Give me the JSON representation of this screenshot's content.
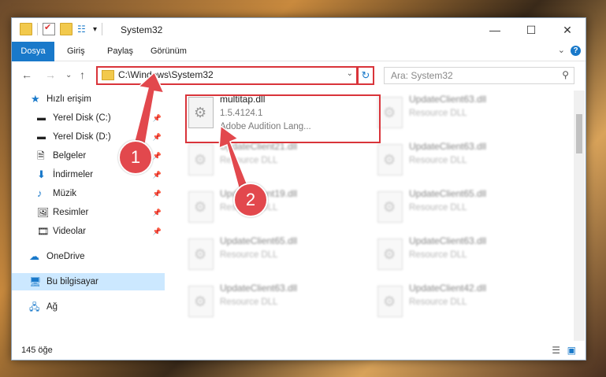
{
  "window": {
    "title": "System32"
  },
  "ribbon": {
    "tabs": [
      "Dosya",
      "Giriş",
      "Paylaş",
      "Görünüm"
    ],
    "help": "?"
  },
  "address": {
    "path": "C:\\Windows\\System32"
  },
  "search": {
    "placeholder": "Ara: System32"
  },
  "nav": {
    "items": [
      {
        "label": "Hızlı erişim"
      },
      {
        "label": "Yerel Disk (C:)"
      },
      {
        "label": "Yerel Disk (D:)"
      },
      {
        "label": "Belgeler"
      },
      {
        "label": "İndirmeler"
      },
      {
        "label": "Müzik"
      },
      {
        "label": "Resimler"
      },
      {
        "label": "Videolar"
      },
      {
        "label": "OneDrive"
      },
      {
        "label": "Bu bilgisayar"
      },
      {
        "label": "Ağ"
      }
    ]
  },
  "files": [
    {
      "name": "multitap.dll",
      "version": "1.5.4124.1",
      "description": "Adobe Audition Lang..."
    },
    {
      "name": "UpdateClient63.dll",
      "description": "Resource DLL"
    },
    {
      "name": "UpdateClient21.dll",
      "description": "Resource DLL"
    },
    {
      "name": "UpdateClient63.dll",
      "description": "Resource DLL"
    },
    {
      "name": "UpdateClient19.dll",
      "description": "Resource DLL"
    },
    {
      "name": "UpdateClient65.dll",
      "description": "Resource DLL"
    },
    {
      "name": "UpdateClient65.dll",
      "description": "Resource DLL"
    },
    {
      "name": "UpdateClient63.dll",
      "description": "Resource DLL"
    },
    {
      "name": "UpdateClient63.dll",
      "description": "Resource DLL"
    },
    {
      "name": "UpdateClient42.dll",
      "description": "Resource DLL"
    }
  ],
  "status": {
    "count": "145 öğe"
  },
  "badges": [
    "1",
    "2"
  ],
  "colors": {
    "accent": "#1979ca",
    "highlight": "#d9343a"
  }
}
